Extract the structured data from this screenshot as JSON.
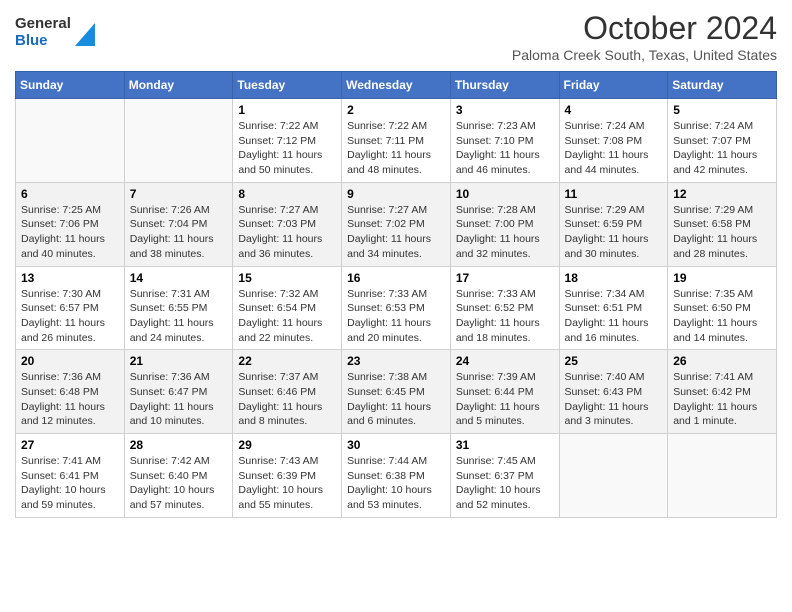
{
  "header": {
    "logo": {
      "general": "General",
      "blue": "Blue"
    },
    "title": "October 2024",
    "subtitle": "Paloma Creek South, Texas, United States"
  },
  "days_of_week": [
    "Sunday",
    "Monday",
    "Tuesday",
    "Wednesday",
    "Thursday",
    "Friday",
    "Saturday"
  ],
  "weeks": [
    [
      {
        "num": "",
        "info": ""
      },
      {
        "num": "",
        "info": ""
      },
      {
        "num": "1",
        "info": "Sunrise: 7:22 AM\nSunset: 7:12 PM\nDaylight: 11 hours and 50 minutes."
      },
      {
        "num": "2",
        "info": "Sunrise: 7:22 AM\nSunset: 7:11 PM\nDaylight: 11 hours and 48 minutes."
      },
      {
        "num": "3",
        "info": "Sunrise: 7:23 AM\nSunset: 7:10 PM\nDaylight: 11 hours and 46 minutes."
      },
      {
        "num": "4",
        "info": "Sunrise: 7:24 AM\nSunset: 7:08 PM\nDaylight: 11 hours and 44 minutes."
      },
      {
        "num": "5",
        "info": "Sunrise: 7:24 AM\nSunset: 7:07 PM\nDaylight: 11 hours and 42 minutes."
      }
    ],
    [
      {
        "num": "6",
        "info": "Sunrise: 7:25 AM\nSunset: 7:06 PM\nDaylight: 11 hours and 40 minutes."
      },
      {
        "num": "7",
        "info": "Sunrise: 7:26 AM\nSunset: 7:04 PM\nDaylight: 11 hours and 38 minutes."
      },
      {
        "num": "8",
        "info": "Sunrise: 7:27 AM\nSunset: 7:03 PM\nDaylight: 11 hours and 36 minutes."
      },
      {
        "num": "9",
        "info": "Sunrise: 7:27 AM\nSunset: 7:02 PM\nDaylight: 11 hours and 34 minutes."
      },
      {
        "num": "10",
        "info": "Sunrise: 7:28 AM\nSunset: 7:00 PM\nDaylight: 11 hours and 32 minutes."
      },
      {
        "num": "11",
        "info": "Sunrise: 7:29 AM\nSunset: 6:59 PM\nDaylight: 11 hours and 30 minutes."
      },
      {
        "num": "12",
        "info": "Sunrise: 7:29 AM\nSunset: 6:58 PM\nDaylight: 11 hours and 28 minutes."
      }
    ],
    [
      {
        "num": "13",
        "info": "Sunrise: 7:30 AM\nSunset: 6:57 PM\nDaylight: 11 hours and 26 minutes."
      },
      {
        "num": "14",
        "info": "Sunrise: 7:31 AM\nSunset: 6:55 PM\nDaylight: 11 hours and 24 minutes."
      },
      {
        "num": "15",
        "info": "Sunrise: 7:32 AM\nSunset: 6:54 PM\nDaylight: 11 hours and 22 minutes."
      },
      {
        "num": "16",
        "info": "Sunrise: 7:33 AM\nSunset: 6:53 PM\nDaylight: 11 hours and 20 minutes."
      },
      {
        "num": "17",
        "info": "Sunrise: 7:33 AM\nSunset: 6:52 PM\nDaylight: 11 hours and 18 minutes."
      },
      {
        "num": "18",
        "info": "Sunrise: 7:34 AM\nSunset: 6:51 PM\nDaylight: 11 hours and 16 minutes."
      },
      {
        "num": "19",
        "info": "Sunrise: 7:35 AM\nSunset: 6:50 PM\nDaylight: 11 hours and 14 minutes."
      }
    ],
    [
      {
        "num": "20",
        "info": "Sunrise: 7:36 AM\nSunset: 6:48 PM\nDaylight: 11 hours and 12 minutes."
      },
      {
        "num": "21",
        "info": "Sunrise: 7:36 AM\nSunset: 6:47 PM\nDaylight: 11 hours and 10 minutes."
      },
      {
        "num": "22",
        "info": "Sunrise: 7:37 AM\nSunset: 6:46 PM\nDaylight: 11 hours and 8 minutes."
      },
      {
        "num": "23",
        "info": "Sunrise: 7:38 AM\nSunset: 6:45 PM\nDaylight: 11 hours and 6 minutes."
      },
      {
        "num": "24",
        "info": "Sunrise: 7:39 AM\nSunset: 6:44 PM\nDaylight: 11 hours and 5 minutes."
      },
      {
        "num": "25",
        "info": "Sunrise: 7:40 AM\nSunset: 6:43 PM\nDaylight: 11 hours and 3 minutes."
      },
      {
        "num": "26",
        "info": "Sunrise: 7:41 AM\nSunset: 6:42 PM\nDaylight: 11 hours and 1 minute."
      }
    ],
    [
      {
        "num": "27",
        "info": "Sunrise: 7:41 AM\nSunset: 6:41 PM\nDaylight: 10 hours and 59 minutes."
      },
      {
        "num": "28",
        "info": "Sunrise: 7:42 AM\nSunset: 6:40 PM\nDaylight: 10 hours and 57 minutes."
      },
      {
        "num": "29",
        "info": "Sunrise: 7:43 AM\nSunset: 6:39 PM\nDaylight: 10 hours and 55 minutes."
      },
      {
        "num": "30",
        "info": "Sunrise: 7:44 AM\nSunset: 6:38 PM\nDaylight: 10 hours and 53 minutes."
      },
      {
        "num": "31",
        "info": "Sunrise: 7:45 AM\nSunset: 6:37 PM\nDaylight: 10 hours and 52 minutes."
      },
      {
        "num": "",
        "info": ""
      },
      {
        "num": "",
        "info": ""
      }
    ]
  ]
}
